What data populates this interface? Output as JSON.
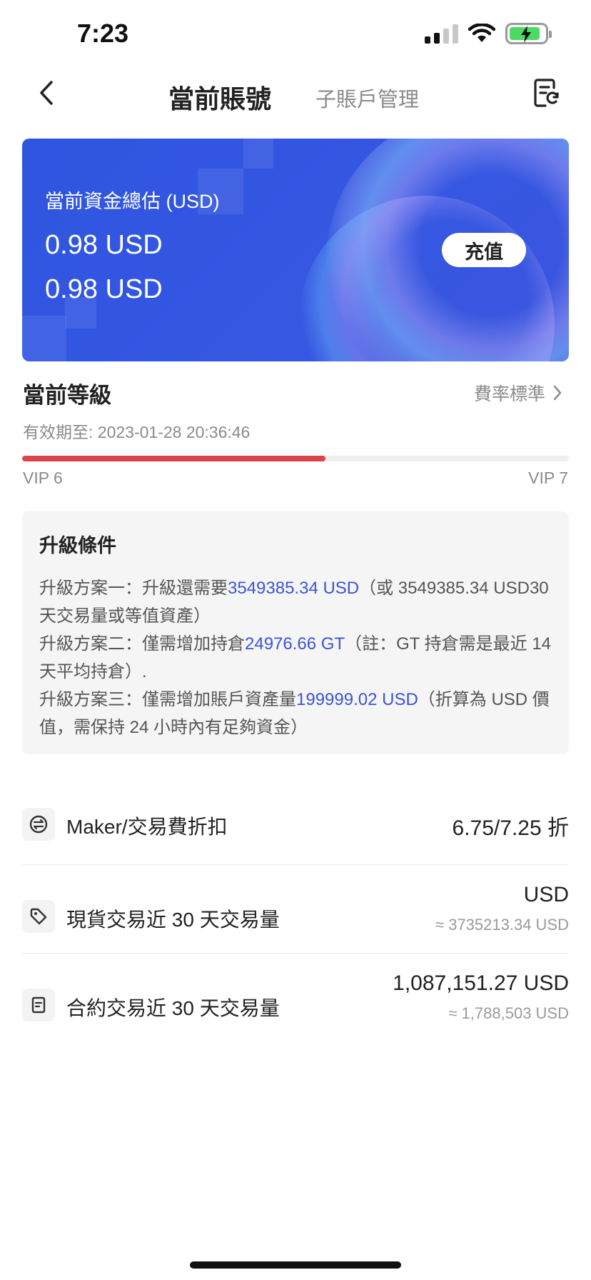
{
  "status": {
    "time": "7:23",
    "battery_color": "#4cd964"
  },
  "nav": {
    "tab_current": "當前賬號",
    "tab_sub": "子賬戶管理"
  },
  "card": {
    "label": "當前資金總估 (USD)",
    "amount_1": "0.98 USD",
    "amount_2": "0.98 USD",
    "recharge_label": "充值",
    "accent": "#3557e2"
  },
  "level": {
    "title": "當前等級",
    "fee_link": "費率標準",
    "valid_until": "有效期至: 2023-01-28 20:36:46",
    "current_vip": "VIP 6",
    "next_vip": "VIP 7",
    "progress_fraction": 0.555,
    "progress_color": "#d9454a"
  },
  "upgrade": {
    "title": "升級條件",
    "plan1_prefix": "升級方案一：升級還需要",
    "plan1_highlight": "3549385.34 USD",
    "plan1_suffix": "（或 3549385.34 USD30 天交易量或等值資產）",
    "plan2_prefix": "升級方案二：僅需增加持倉",
    "plan2_highlight": "24976.66 GT",
    "plan2_suffix": "（註：GT 持倉需是最近 14 天平均持倉）.",
    "plan3_prefix": "升級方案三：僅需增加賬戶資產量",
    "plan3_highlight": "199999.02 USD",
    "plan3_suffix": "（折算為 USD 價值，需保持 24 小時內有足夠資金）",
    "highlight_color": "#3b55d6"
  },
  "stats": {
    "fee_label": "Maker/交易費折扣",
    "fee_value": "6.75/7.25 折",
    "spot_label": "現貨交易近 30 天交易量",
    "spot_value": "USD",
    "spot_sub": "≈ 3735213.34 USD",
    "futures_label": "合約交易近 30 天交易量",
    "futures_value": "1,087,151.27 USD",
    "futures_sub": "≈ 1,788,503 USD"
  }
}
